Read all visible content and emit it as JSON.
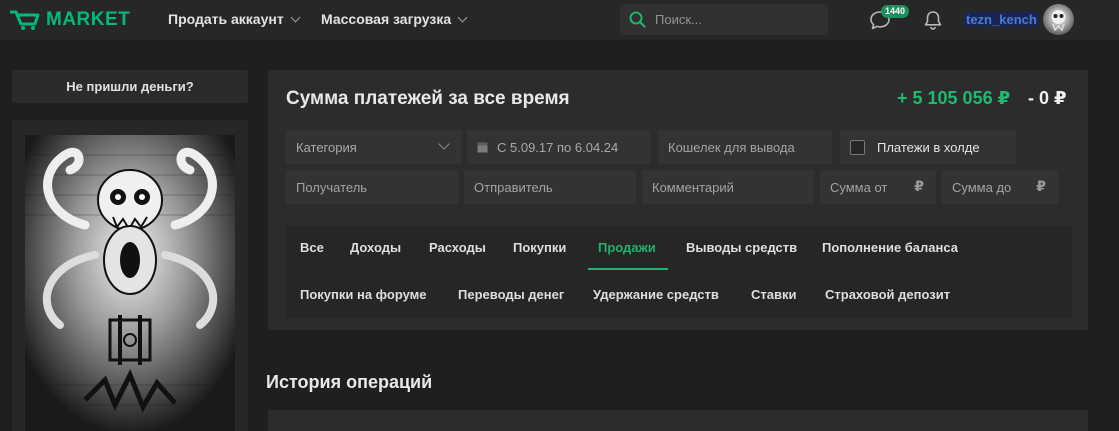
{
  "header": {
    "logo_text": "MARKET",
    "nav": [
      {
        "label": "Продать аккаунт"
      },
      {
        "label": "Массовая загрузка"
      }
    ],
    "search_placeholder": "Поиск...",
    "messages_badge": "1440",
    "username": "tezn_kench",
    "accent_color": "#00ba78"
  },
  "sidebar": {
    "no_money_button": "Не пришли деньги?"
  },
  "payments": {
    "title": "Сумма платежей за все время",
    "income_total": "+ 5 105 056 ₽",
    "expense_total": "- 0 ₽",
    "filters": {
      "category_placeholder": "Категория",
      "date_range": "С 5.09.17 по 6.04.24",
      "wallet_placeholder": "Кошелек для вывода",
      "hold_label": "Платежи в холде",
      "hold_checked": false,
      "recipient_placeholder": "Получатель",
      "sender_placeholder": "Отправитель",
      "comment_placeholder": "Комментарий",
      "amount_from_placeholder": "Сумма от",
      "amount_to_placeholder": "Сумма до",
      "currency_symbol": "₽"
    },
    "tabs_row1": [
      "Все",
      "Доходы",
      "Расходы",
      "Покупки",
      "Продажи",
      "Выводы средств",
      "Пополнение баланса"
    ],
    "tabs_row2": [
      "Покупки на форуме",
      "Переводы денег",
      "Удержание средств",
      "Ставки",
      "Страховой депозит"
    ],
    "active_tab": "Продажи"
  },
  "history": {
    "title": "История операций"
  }
}
